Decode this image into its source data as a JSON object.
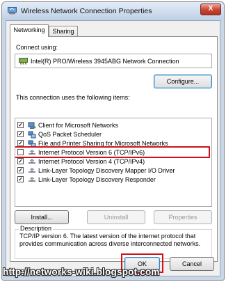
{
  "window": {
    "title": "Wireless Network Connection Properties",
    "close_label": "X"
  },
  "tabs": [
    {
      "label": "Networking",
      "active": true
    },
    {
      "label": "Sharing",
      "active": false
    }
  ],
  "connect_using": {
    "label": "Connect using:",
    "adapter": "Intel(R) PRO/Wireless 3945ABG Network Connection",
    "configure_label": "Configure..."
  },
  "items_section": {
    "label": "This connection uses the following items:",
    "items": [
      {
        "label": "Client for Microsoft Networks",
        "checked": true,
        "icon": "network-client-icon"
      },
      {
        "label": "QoS Packet Scheduler",
        "checked": true,
        "icon": "network-service-icon"
      },
      {
        "label": "File and Printer Sharing for Microsoft Networks",
        "checked": true,
        "icon": "network-service-icon"
      },
      {
        "label": "Internet Protocol Version 6 (TCP/IPv6)",
        "checked": false,
        "icon": "protocol-icon",
        "highlighted": true
      },
      {
        "label": "Internet Protocol Version 4 (TCP/IPv4)",
        "checked": true,
        "icon": "protocol-icon"
      },
      {
        "label": "Link-Layer Topology Discovery Mapper I/O Driver",
        "checked": true,
        "icon": "protocol-icon"
      },
      {
        "label": "Link-Layer Topology Discovery Responder",
        "checked": true,
        "icon": "protocol-icon"
      }
    ],
    "install_label": "Install...",
    "uninstall_label": "Uninstall",
    "properties_label": "Properties"
  },
  "description": {
    "label": "Description",
    "text": "TCP/IP version 6. The latest version of the internet protocol that provides communication across diverse interconnected networks."
  },
  "footer": {
    "ok_label": "OK",
    "cancel_label": "Cancel"
  },
  "watermark": "http://networks-wiki.blogspot.com",
  "colors": {
    "highlight_red": "#d0131a",
    "title_gradient_top": "#e3ecf7",
    "close_red": "#c9402c"
  }
}
